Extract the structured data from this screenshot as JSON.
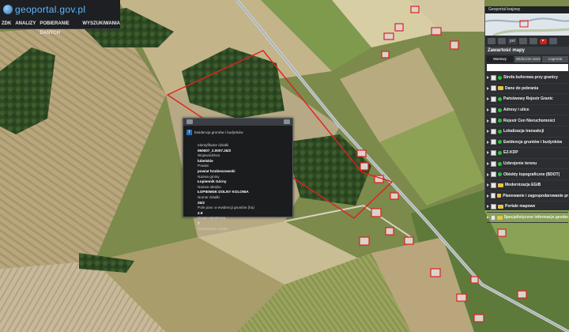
{
  "header": {
    "logo_text": "geoportal.gov.pl",
    "menu": [
      "ZDK",
      "ANALIZY",
      "POBIERANIE DANYCH",
      "WYSZUKIWANIA"
    ]
  },
  "right_panel": {
    "minimap_title": "Geoportal krajowy",
    "language_value": "pol",
    "content_title": "Zawartość mapy",
    "tabs": [
      "Warstwy",
      "Widoczne warstwy",
      "Legenda"
    ],
    "layers": [
      {
        "label": "Strefa buforowa przy granicy",
        "icon": "dot-icon"
      },
      {
        "label": "Dane do pobrania",
        "icon": "folder-icon"
      },
      {
        "label": "Państwowy Rejestr Granic",
        "icon": "dot-icon"
      },
      {
        "label": "Adresy i ulice",
        "icon": "dot-icon"
      },
      {
        "label": "Rejestr Cen Nieruchomości",
        "icon": "dot-icon"
      },
      {
        "label": "Lokalizacja transakcji",
        "icon": "dot-icon"
      },
      {
        "label": "Ewidencja gruntów i budynków",
        "icon": "dot-icon"
      },
      {
        "label": "EZ-KDP",
        "icon": "dot-icon"
      },
      {
        "label": "Uzbrojenie terenu",
        "icon": "dot-icon"
      },
      {
        "label": "Obiekty topograficzne (BDOT)",
        "icon": "dot-icon"
      },
      {
        "label": "Modernizacja EGiB",
        "icon": "folder-icon"
      },
      {
        "label": "Planowanie i zagospodarowanie przestrzenne",
        "icon": "folder-icon"
      },
      {
        "label": "Portale mapowe",
        "icon": "folder-icon"
      },
      {
        "label": "Specjalistyczne informacje geodezyjne",
        "icon": "folder-icon"
      }
    ]
  },
  "popup": {
    "title": "Ewidencja gruntów i budynków",
    "rows": [
      {
        "text": "Identyfikator działki",
        "value": false
      },
      {
        "text": "060607_2.0007.25/2",
        "value": true
      },
      {
        "text": "Województwo",
        "value": false
      },
      {
        "text": "lubelskie",
        "value": true
      },
      {
        "text": "Powiat",
        "value": false
      },
      {
        "text": "powiat hrubieszowski",
        "value": true
      },
      {
        "text": "Nazwa gminy",
        "value": false
      },
      {
        "text": "Łopiennik Górny",
        "value": true
      },
      {
        "text": "Nazwa obrębu",
        "value": false
      },
      {
        "text": "ŁOPIENNIK DOLNY KOLONIA",
        "value": true
      },
      {
        "text": "Numer działki",
        "value": false
      },
      {
        "text": "25/2",
        "value": true
      },
      {
        "text": "Pole pow. w ewidencji gruntów (ha)",
        "value": false
      },
      {
        "text": "2.9",
        "value": true
      },
      {
        "text": "Grupa rejestrowa",
        "value": false
      },
      {
        "text": "7",
        "value": true
      },
      {
        "text": "Oznaczenie użytku",
        "value": false
      }
    ]
  },
  "colors": {
    "parcel_outline": "#e02020",
    "panel_bg": "#2b2d30",
    "accent_blue": "#5fb8ff"
  }
}
